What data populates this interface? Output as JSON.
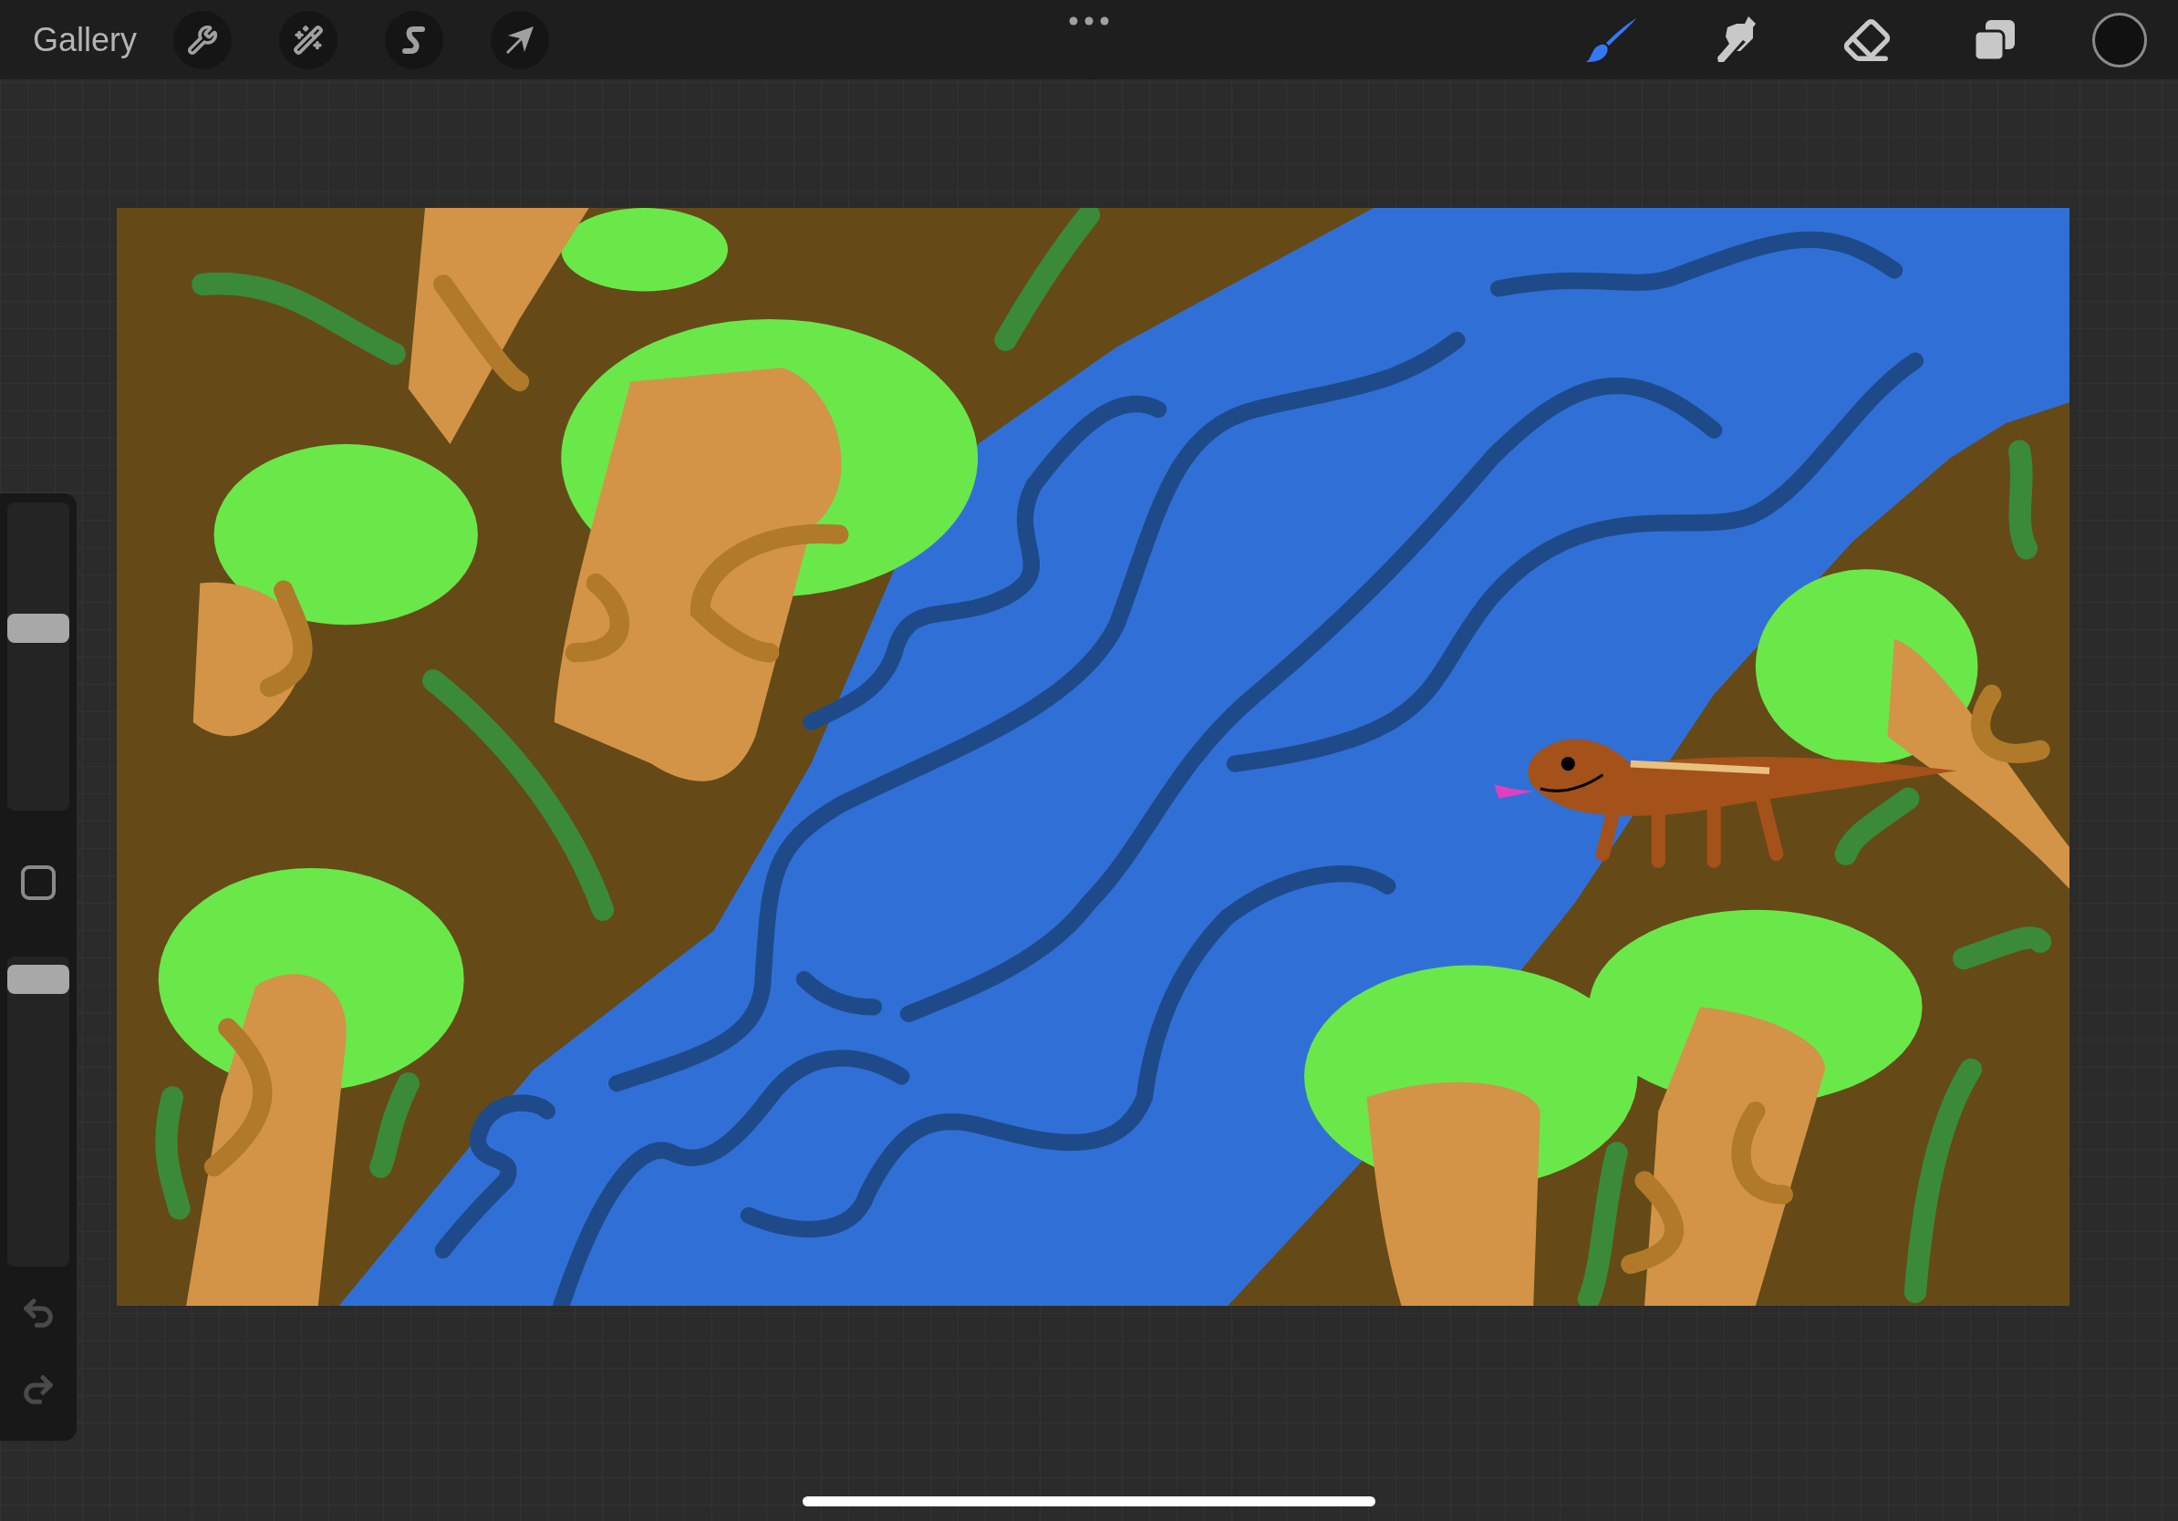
{
  "toolbar": {
    "gallery": "Gallery"
  },
  "tools": [
    {
      "kind": "brush",
      "selected": true
    },
    {
      "kind": "smudge",
      "selected": false
    },
    {
      "kind": "eraser",
      "selected": false
    }
  ],
  "sidebar": {
    "brush_size": {
      "level": 0.6
    },
    "opacity": {
      "level": 0.97
    }
  }
}
